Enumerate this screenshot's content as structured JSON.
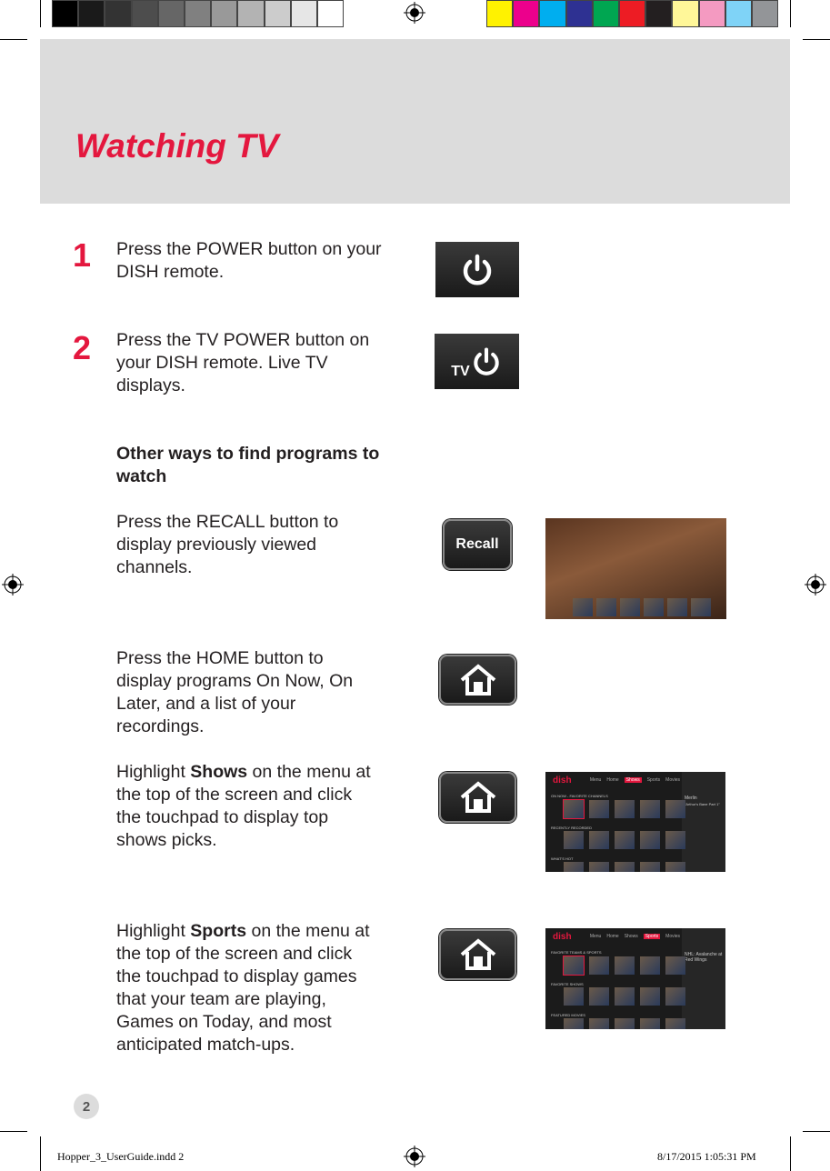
{
  "colors": {
    "accent": "#e4173e",
    "header_bg": "#dcdcdc",
    "gray_bars": [
      "#000000",
      "#1a1a1a",
      "#333333",
      "#4d4d4d",
      "#666666",
      "#808080",
      "#999999",
      "#b3b3b3",
      "#cccccc",
      "#e6e6e6",
      "#ffffff"
    ],
    "color_bars": [
      "#fff200",
      "#ec008c",
      "#00aeef",
      "#2e3192",
      "#00a651",
      "#ed1c24",
      "#231f20",
      "#fff799",
      "#f49ac1",
      "#7fd3f7",
      "#939598"
    ]
  },
  "title": "Watching TV",
  "steps": [
    {
      "number": "1",
      "text": "Press the POWER button on your DISH remote.",
      "icon": "power-icon"
    },
    {
      "number": "2",
      "text": "Press the TV POWER button on your DISH remote.  Live TV displays.",
      "icon": "tv-power-icon",
      "button_label": "TV"
    }
  ],
  "other_ways": {
    "heading": "Other ways to find programs to watch",
    "recall": {
      "text": "Press the RECALL button to display previously viewed channels.",
      "button_label": "Recall"
    },
    "home": {
      "text": "Press the HOME button to display programs On Now, On Later, and a list of your recordings.",
      "icon": "home-icon"
    },
    "shows": {
      "pre": "Highlight ",
      "bold": "Shows",
      "post": " on the menu at the top of the screen and click the touchpad to display top shows picks."
    },
    "sports": {
      "pre": "Highlight ",
      "bold": "Sports",
      "post": " on the menu at the top of the screen and click the touchpad to display games that your team are playing, Games on Today, and most anticipated match-ups."
    }
  },
  "screens": {
    "logo": "dish",
    "menu": [
      "Menu",
      "Home",
      "Shows",
      "Sports",
      "Movies"
    ],
    "shows_rows": [
      "ON NOW - FAVORITE CHANNELS",
      "RECENTLY RECORDED",
      "WHAT'S HOT"
    ],
    "shows_side": {
      "title": "Merlin",
      "episode": "\"Arthur's Bane Part 1\"",
      "channel": "BBCA 133"
    },
    "sports_rows": [
      "FAVORITE TEAMS & SPORTS",
      "FAVORITE SHOWS",
      "FEATURED MOVIES"
    ],
    "sports_side": {
      "title": "NHL: Avalanche at Red Wings"
    }
  },
  "page_number": "2",
  "footer": {
    "file": "Hopper_3_UserGuide.indd   2",
    "timestamp": "8/17/2015   1:05:31 PM"
  }
}
